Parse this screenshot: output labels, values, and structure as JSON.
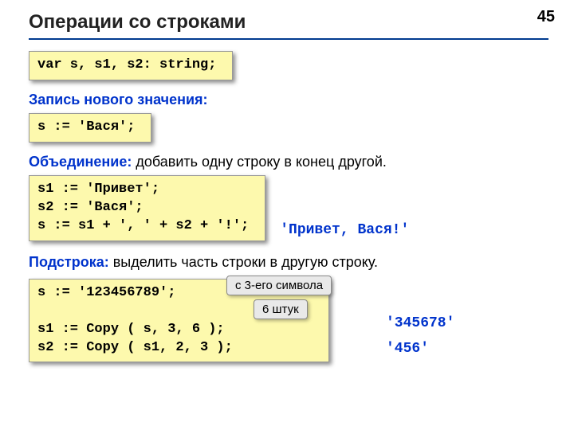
{
  "page_number": "45",
  "title": "Операции со строками",
  "code1": "var s, s1, s2: string;",
  "section_assign": "Запись нового значения:",
  "code2": "s := 'Вася';",
  "section_concat_label": "Объединение:",
  "section_concat_desc": " добавить одну строку в конец другой.",
  "code3": "s1 := 'Привет';\ns2 := 'Вася';\ns := s1 + ', ' + s2 + '!';",
  "result_concat": "'Привет, Вася!'",
  "section_sub_label": "Подстрока:",
  "section_sub_desc": " выделить часть строки в другую строку.",
  "code4": "s := '123456789';\n\ns1 := Copy ( s, 3, 6 );\ns2 := Copy ( s1, 2, 3 );",
  "callout_from": "с 3-его символа",
  "callout_count": "6 штук",
  "result_sub1": "'345678'",
  "result_sub2": "'456'"
}
